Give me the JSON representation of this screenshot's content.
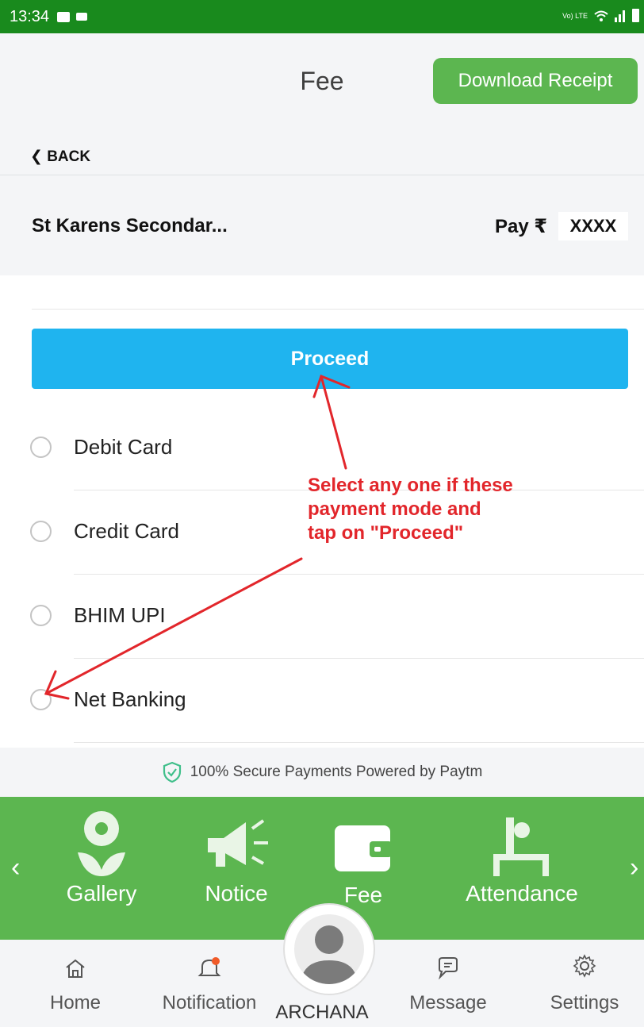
{
  "status_bar": {
    "time": "13:34",
    "network": "Vo) LTE"
  },
  "header": {
    "title": "Fee",
    "download_receipt": "Download Receipt"
  },
  "nav": {
    "back": "BACK"
  },
  "school": {
    "name": "St Karens Secondar...",
    "pay_label": "Pay ₹",
    "amount": "XXXX"
  },
  "proceed_label": "Proceed",
  "payment_options": [
    {
      "label": "Debit Card"
    },
    {
      "label": "Credit Card"
    },
    {
      "label": "BHIM UPI"
    },
    {
      "label": "Net Banking"
    }
  ],
  "annotation": {
    "text": "Select any one if these payment mode and tap on \"Proceed\""
  },
  "secure_text": "100% Secure Payments Powered by Paytm",
  "modules": [
    {
      "label": "Gallery",
      "icon": "flower-icon"
    },
    {
      "label": "Notice",
      "icon": "megaphone-icon"
    },
    {
      "label": "Fee",
      "icon": "wallet-icon"
    },
    {
      "label": "Attendance",
      "icon": "desk-person-icon"
    }
  ],
  "bottom_nav": {
    "home": "Home",
    "notification": "Notification",
    "user": "ARCHANA",
    "message": "Message",
    "settings": "Settings"
  },
  "colors": {
    "status_green": "#198a1d",
    "brand_green": "#5cb650",
    "proceed_blue": "#1fb4ef",
    "annotation_red": "#e2262b"
  }
}
